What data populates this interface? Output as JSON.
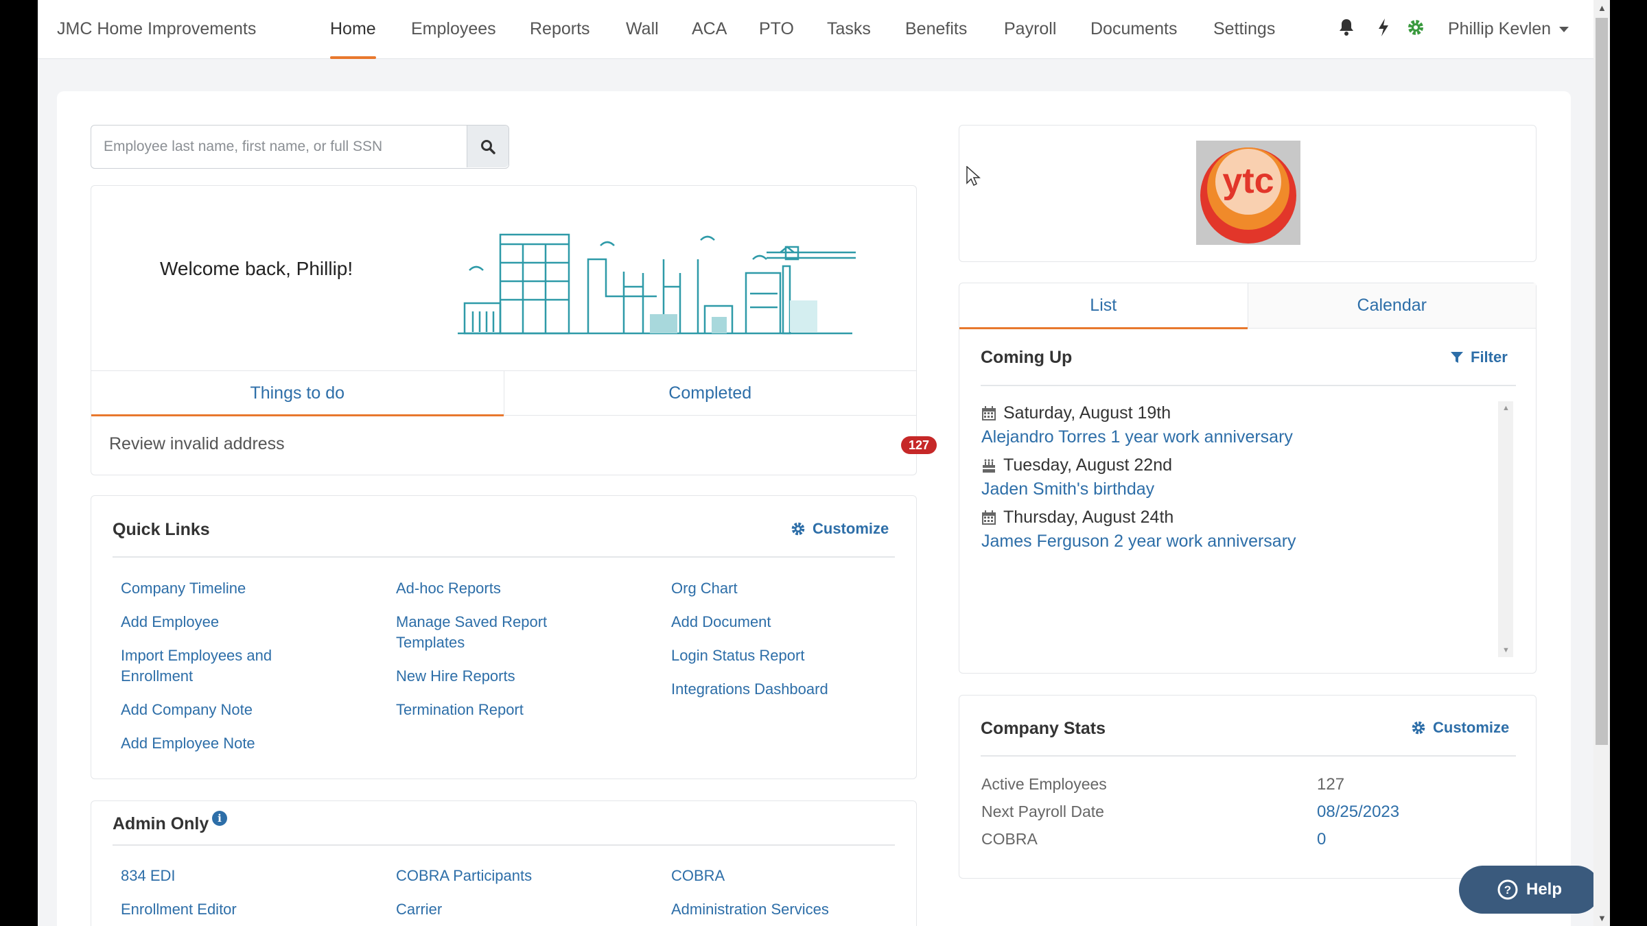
{
  "nav": {
    "brand": "JMC Home Improvements",
    "items": [
      {
        "label": "Home",
        "active": true
      },
      {
        "label": "Employees"
      },
      {
        "label": "Reports"
      },
      {
        "label": "Wall"
      },
      {
        "label": "ACA"
      },
      {
        "label": "PTO"
      },
      {
        "label": "Tasks"
      },
      {
        "label": "Benefits"
      },
      {
        "label": "Payroll"
      },
      {
        "label": "Documents"
      },
      {
        "label": "Settings"
      }
    ],
    "icons": [
      "bell-icon",
      "bolt-icon",
      "gear-icon"
    ],
    "user": "Phillip Kevlen"
  },
  "search": {
    "placeholder": "Employee last name, first name, or full SSN",
    "value": ""
  },
  "welcome": {
    "text": "Welcome back, Phillip!",
    "tabs": [
      "Things to do",
      "Completed"
    ],
    "task": {
      "label": "Review invalid address",
      "count": "127"
    }
  },
  "quick_links": {
    "title": "Quick Links",
    "customize": "Customize",
    "columns": [
      [
        "Company Timeline",
        "Add Employee",
        "Import Employees and Enrollment",
        "Add Company Note",
        "Add Employee Note"
      ],
      [
        "Ad-hoc Reports",
        "Manage Saved Report Templates",
        "New Hire Reports",
        "Termination Report"
      ],
      [
        "Org Chart",
        "Add Document",
        "Login Status Report",
        "Integrations Dashboard"
      ]
    ]
  },
  "admin": {
    "title": "Admin Only",
    "columns": [
      [
        "834 EDI",
        "Enrollment Editor"
      ],
      [
        "COBRA Participants",
        "Carrier"
      ],
      [
        "COBRA",
        "Administration Services"
      ]
    ]
  },
  "logo": {
    "text": "ytc"
  },
  "calendar": {
    "tabs": [
      "List",
      "Calendar"
    ],
    "title": "Coming Up",
    "filter": "Filter",
    "events": [
      {
        "date": "Saturday, August 19th",
        "title": "Alejandro Torres 1 year work anniversary"
      },
      {
        "date": "Tuesday, August 22nd",
        "title": "Jaden Smith's birthday"
      },
      {
        "date": "Thursday, August 24th",
        "title": "James Ferguson 2 year work anniversary"
      }
    ]
  },
  "stats": {
    "title": "Company Stats",
    "customize": "Customize",
    "rows": [
      {
        "label": "Active Employees",
        "value": "127"
      },
      {
        "label": "Next Payroll Date",
        "value": "08/25/2023"
      },
      {
        "label": "COBRA",
        "value": "0"
      }
    ]
  },
  "help": {
    "label": "Help"
  },
  "colors": {
    "accent": "#e8782d",
    "link": "#2d6ea8",
    "badge": "#c62828",
    "help": "#3a5a7d"
  }
}
